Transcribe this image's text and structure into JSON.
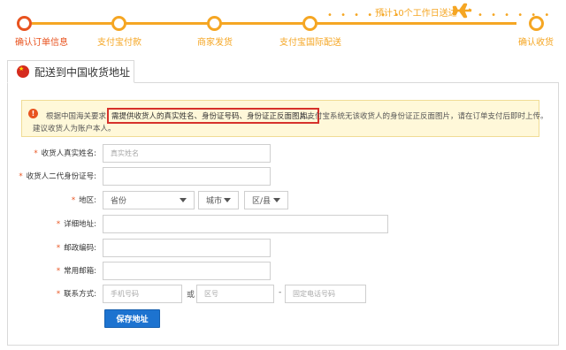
{
  "progress": {
    "steps": [
      {
        "label": "确认订单信息",
        "state": "done"
      },
      {
        "label": "支付宝付款",
        "state": "todo"
      },
      {
        "label": "商家发货",
        "state": "todo"
      },
      {
        "label": "支付宝国际配送",
        "state": "todo"
      },
      {
        "label": "确认收货",
        "state": "todo"
      }
    ],
    "shipping_estimate": "预计10个工作日送达",
    "done_color": "#e8531f",
    "todo_color": "#f5a623"
  },
  "panel": {
    "tab_title": "配送到中国收货地址",
    "flag_icon": "china-flag-icon"
  },
  "notice": {
    "icon": "exclamation-icon",
    "text_before": "根据中国海关要求，",
    "highlight": "需提供收货人的真实姓名、身份证号码、身份证正反面图片。",
    "text_after": "如支付宝系统无该收货人的身份证正反面图片，请在订单支付后即时上传。",
    "text_line2": "建议收货人为账户本人。"
  },
  "form": {
    "name_label": "收货人真实姓名:",
    "name_placeholder": "真实姓名",
    "id_label": "收货人二代身份证号:",
    "region_label": "地区:",
    "province": "省份",
    "city": "城市",
    "district": "区/县",
    "address_label": "详细地址:",
    "postcode_label": "邮政编码:",
    "email_label": "常用邮箱:",
    "contact_label": "联系方式:",
    "mobile_placeholder": "手机号码",
    "or_text": "或",
    "area_code_placeholder": "区号",
    "dash": "-",
    "landline_placeholder": "固定电话号码",
    "save_button": "保存地址"
  }
}
